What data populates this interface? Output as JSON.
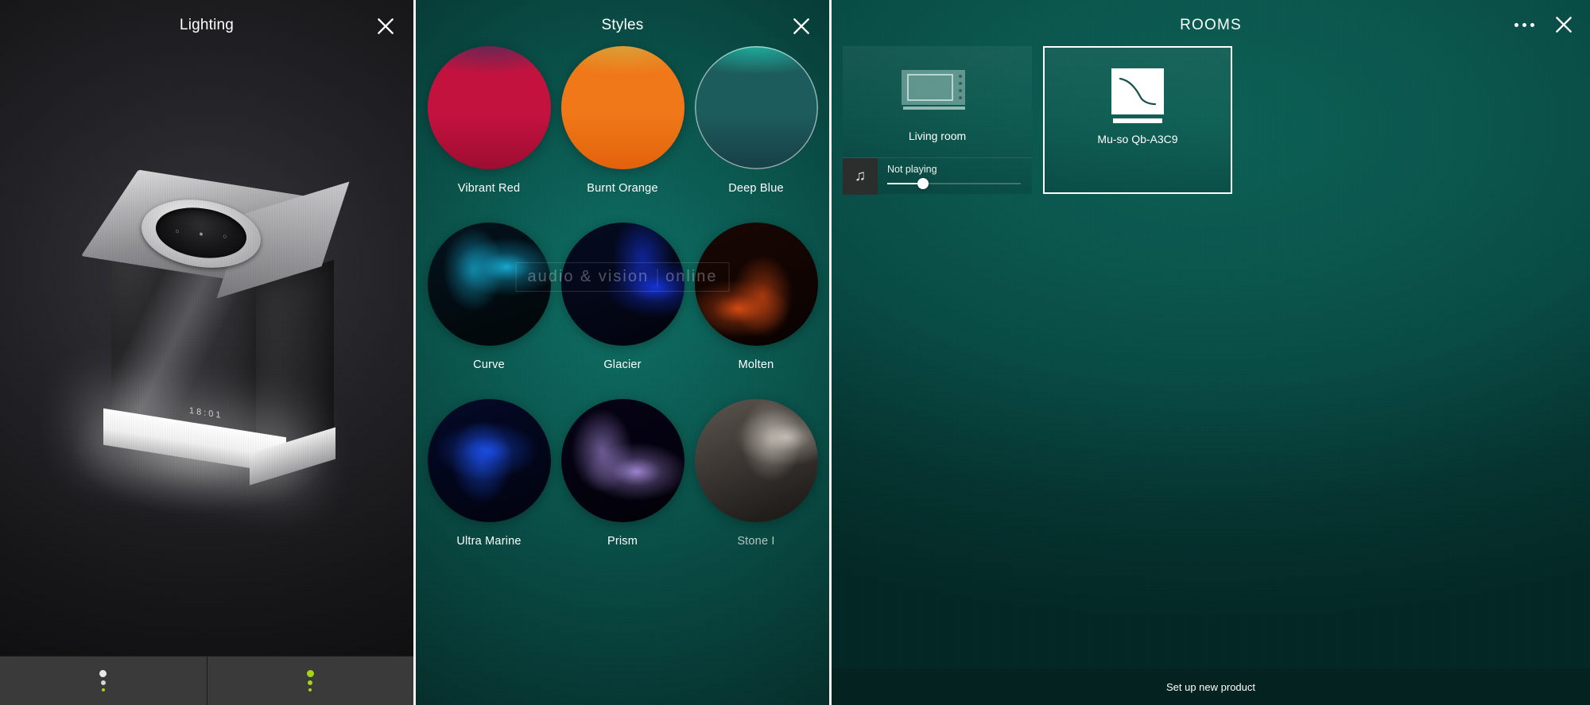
{
  "panels": {
    "lighting": {
      "title": "Lighting",
      "close_icon": "close-icon",
      "device_display": "18:01",
      "tabs": [
        {
          "name": "lighting-brightness-tab",
          "dot_color": "#e8e8e8",
          "accent_color": "#a4d614"
        },
        {
          "name": "lighting-style-tab",
          "dot_color": "#a4d614",
          "accent_color": "#a4d614"
        }
      ]
    },
    "styles": {
      "title": "Styles",
      "close_icon": "close-icon",
      "watermark": {
        "left": "audio & vision",
        "right": "online"
      },
      "items": [
        {
          "label": "Vibrant Red",
          "kind": "solid",
          "c1": "#c4123f",
          "c2": "#9e0d32",
          "top": "#5b2a56"
        },
        {
          "label": "Burnt Orange",
          "kind": "solid",
          "c1": "#f07818",
          "c2": "#e2620c",
          "top": "#d8a43a"
        },
        {
          "label": "Deep Blue",
          "kind": "solid",
          "c1": "#1d5c5d",
          "c2": "#173f46",
          "top": "#1fb9a6",
          "ring": true
        },
        {
          "label": "Curve",
          "kind": "image",
          "c1": "#04131d",
          "c2": "#010608",
          "accent": "#1ad0ff"
        },
        {
          "label": "Glacier",
          "kind": "image",
          "c1": "#050b22",
          "c2": "#02040d",
          "accent": "#1a3cff"
        },
        {
          "label": "Molten",
          "kind": "image",
          "c1": "#1a0703",
          "c2": "#080201",
          "accent": "#ff5a18"
        },
        {
          "label": "Ultra Marine",
          "kind": "image",
          "c1": "#040a28",
          "c2": "#01030e",
          "accent": "#1e56ff"
        },
        {
          "label": "Prism",
          "kind": "image",
          "c1": "#060316",
          "c2": "#020108",
          "accent": "#c2a4ff"
        },
        {
          "label": "Stone I",
          "kind": "image",
          "c1": "#5c5550",
          "c2": "#171412",
          "accent": "#d8d2c8",
          "dim": true
        }
      ]
    },
    "rooms": {
      "title": "ROOMS",
      "menu_icon": "overflow-menu-icon",
      "close_icon": "close-icon",
      "cards": [
        {
          "name": "Living room",
          "icon": "speaker-device-icon",
          "selected": false,
          "now_playing": {
            "icon": "music-note-icon",
            "status": "Not playing",
            "volume_percent": 27
          }
        },
        {
          "name": "Mu-so Qb-A3C9",
          "icon": "muso-qb-icon",
          "selected": true
        }
      ],
      "setup_label": "Set up new product"
    }
  }
}
